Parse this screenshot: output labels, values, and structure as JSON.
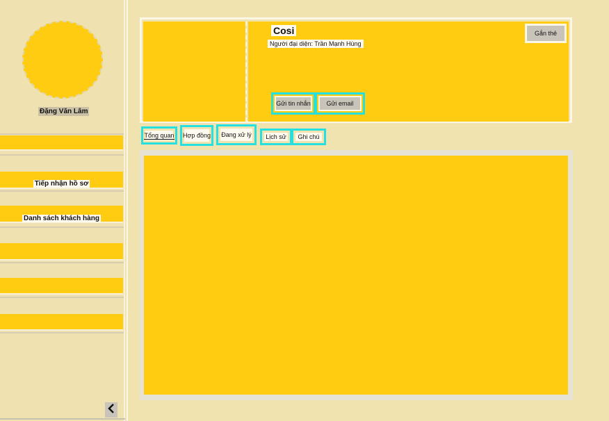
{
  "sidebar": {
    "user_name": "Đặng Văn Lâm",
    "items": [
      {
        "label": ""
      },
      {
        "label": "Tiếp nhận hồ sơ"
      },
      {
        "label": "Danh sách khách hàng"
      },
      {
        "label": ""
      },
      {
        "label": ""
      },
      {
        "label": ""
      }
    ],
    "collapse_icon": "chevron-left-icon"
  },
  "header": {
    "company_name": "Cosi",
    "representative": "Người đại diện: Trần Mạnh Hùng",
    "tag_button": "Gắn thẻ",
    "send_message": "Gửi tin nhắn",
    "send_email": "Gửi email"
  },
  "tabs": [
    {
      "label": "Tổng quan"
    },
    {
      "label": "Hợp đồng"
    },
    {
      "label": "Đang xử lý"
    },
    {
      "label": "Lịch sử"
    },
    {
      "label": "Ghi chú"
    }
  ],
  "colors": {
    "background": "#f0e3b0",
    "accent": "#ffcc11",
    "highlight": "#25e0e0",
    "button": "#c9c4ba"
  }
}
